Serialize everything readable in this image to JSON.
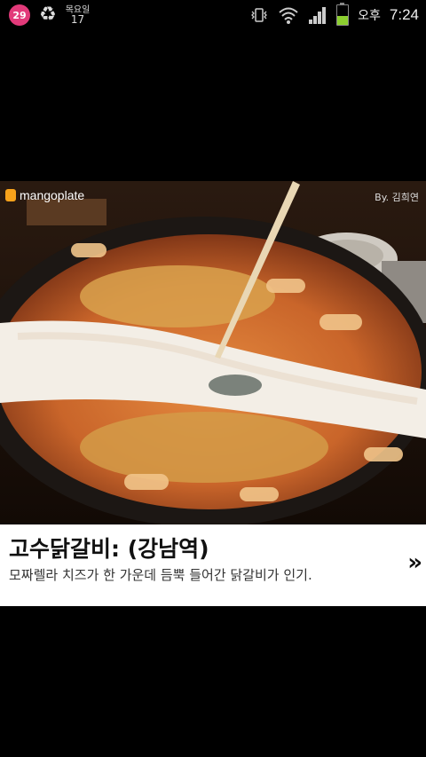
{
  "status_bar": {
    "notification_count": "29",
    "date_day": "목요일",
    "date_num": "17",
    "ampm": "오후",
    "time": "7:24",
    "battery_level": 0.45
  },
  "photo": {
    "logo_text": "mangoplate",
    "credit": "By. 김희연"
  },
  "info": {
    "title": "고수닭갈비: (강남역)",
    "description": "모짜렐라 치즈가 한 가운데 듬뿍 들어간 닭갈비가 인기.",
    "next_label": "»"
  },
  "colors": {
    "accent": "#f7a21b",
    "badge": "#e23a7a",
    "battery": "#8ccf2f"
  }
}
